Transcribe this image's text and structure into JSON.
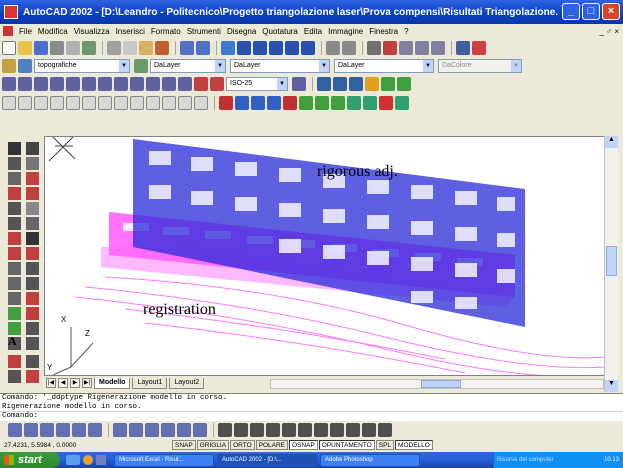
{
  "window": {
    "title": "AutoCAD 2002 - [D:\\Leandro - Politecnico\\Progetto triangolazione laser\\Prova compensi\\Risultati Triangolazione.dwg]",
    "minimize_icon": "minimize-icon",
    "maximize_icon": "maximize-icon",
    "close_icon": "close-icon"
  },
  "menu": {
    "items": [
      "File",
      "Modifica",
      "Visualizza",
      "Inserisci",
      "Formato",
      "Strumenti",
      "Disegna",
      "Quotatura",
      "Edita",
      "Immagine",
      "Finestra",
      "?"
    ],
    "window_controls": "_ ♂ ×"
  },
  "layers_toolbar": {
    "layer_value": "topografiche",
    "layer_name": "DaLayer",
    "linetype_value": "DaLayer",
    "lineweight_value": "DaLayer",
    "plotstyle_value": "DaColore"
  },
  "dim_toolbar": {
    "dimstyle_value": "ISO-25"
  },
  "drawing": {
    "label_rigorous": "rigorous adj.",
    "label_registration": "registration",
    "ucs_x": "X",
    "ucs_y": "Y",
    "ucs_z": "Z"
  },
  "tabs": {
    "items": [
      "Modello",
      "Layout1",
      "Layout2"
    ],
    "active": "Modello"
  },
  "command": {
    "history": [
      "Comando:  '_ddptype Rigenerazione modello in corso.",
      "Rigenerazione modello in corso."
    ],
    "prompt": "Comando:"
  },
  "status": {
    "coords": "27.4231, 5.5984 , 0.0000",
    "modes": [
      "SNAP",
      "GRIGLIA",
      "ORTO",
      "POLARE",
      "OSNAP",
      "OPUNTAMENTO",
      "SPL",
      "MODELLO"
    ],
    "active_modes": [
      "OSNAP",
      "OPUNTAMENTO",
      "MODELLO"
    ]
  },
  "taskbar": {
    "start_label": "start",
    "tasks": [
      "Microsoft Excel - Risul...",
      "AutoCAD 2002 - [D:\\...",
      "Adobe Photoshop"
    ],
    "active_task": "AutoCAD 2002 - [D:\\...",
    "tray_text": "Risorse del computer",
    "clock": "10.13"
  },
  "colors": {
    "blue_cloud": "#2a2ad8",
    "magenta_cloud": "#ff00ff"
  }
}
